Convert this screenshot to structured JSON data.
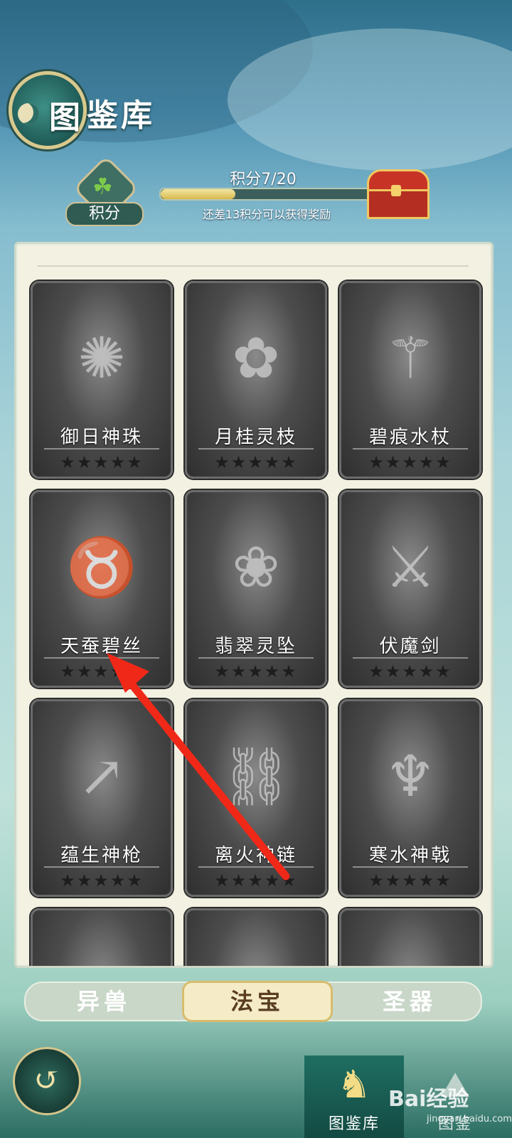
{
  "header": {
    "title_first_char": "图",
    "title_rest": "鉴库"
  },
  "score": {
    "badge_label": "积分",
    "progress_text": "积分7/20",
    "progress_fraction": 0.35,
    "subtitle": "还差13积分可以获得奖励"
  },
  "cards": [
    {
      "name": "御日神珠",
      "stars": "★★★★★",
      "icon": "orb-icon"
    },
    {
      "name": "月桂灵枝",
      "stars": "★★★★★",
      "icon": "branch-icon"
    },
    {
      "name": "碧痕水杖",
      "stars": "★★★★★",
      "icon": "staff-icon"
    },
    {
      "name": "天蚕碧丝",
      "stars": "★★★★★",
      "icon": "silk-icon"
    },
    {
      "name": "翡翠灵坠",
      "stars": "★★★★★",
      "icon": "pendant-icon"
    },
    {
      "name": "伏魔剑",
      "stars": "★★★★★",
      "icon": "sword-icon"
    },
    {
      "name": "蕴生神枪",
      "stars": "★★★★★",
      "icon": "spear-icon"
    },
    {
      "name": "离火神链",
      "stars": "★★★★★",
      "icon": "chain-icon"
    },
    {
      "name": "寒水神戟",
      "stars": "★★★★★",
      "icon": "halberd-icon"
    }
  ],
  "tabs": [
    {
      "label": "异兽",
      "active": false
    },
    {
      "label": "法宝",
      "active": true
    },
    {
      "label": "圣器",
      "active": false
    }
  ],
  "bottom_nav": [
    {
      "label": "图鉴库",
      "active": true,
      "icon": "hero-portrait-icon"
    },
    {
      "label": "图鉴",
      "active": false,
      "icon": "mountain-icon"
    }
  ],
  "watermark": {
    "main": "Bai经验",
    "sub": "jingyan.baidu.com"
  }
}
